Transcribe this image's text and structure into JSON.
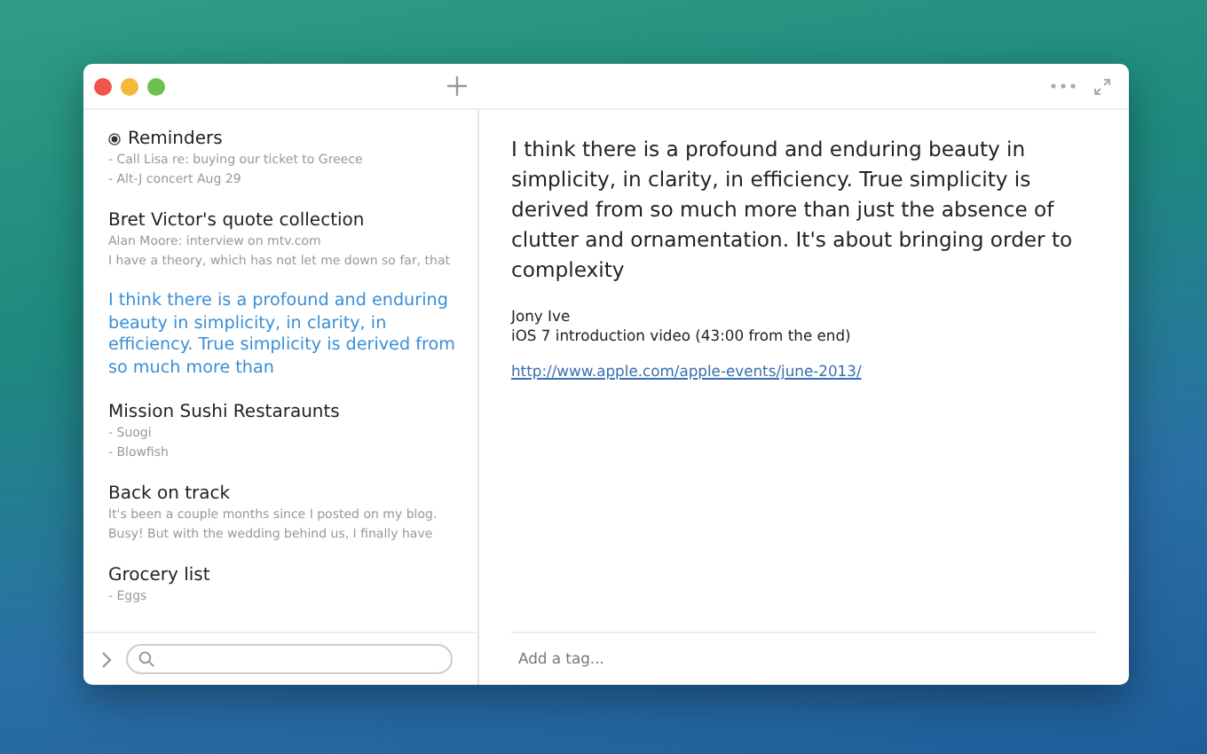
{
  "notes": [
    {
      "title": "Reminders",
      "pinned": true,
      "selected": false,
      "lines": [
        "- Call Lisa re: buying our ticket to Greece",
        "- Alt-J concert Aug 29"
      ]
    },
    {
      "title": "Bret Victor's quote collection",
      "pinned": false,
      "selected": false,
      "lines": [
        "Alan Moore: interview on mtv.com",
        "I have a theory, which has not let me down so far, that"
      ]
    },
    {
      "pinned": false,
      "selected": true,
      "lines": [
        "I think there is a profound and enduring beauty in simplicity, in clarity, in efficiency. True simplicity is derived from so much more than"
      ]
    },
    {
      "title": "Mission Sushi Restaraunts",
      "pinned": false,
      "selected": false,
      "lines": [
        "- Suogi",
        "- Blowfish"
      ]
    },
    {
      "title": "Back on track",
      "pinned": false,
      "selected": false,
      "lines": [
        "It's been a couple months since I posted on my blog.",
        "Busy! But with the wedding behind us, I finally have"
      ]
    },
    {
      "title": "Grocery list",
      "pinned": false,
      "selected": false,
      "lines": [
        "- Eggs"
      ]
    }
  ],
  "editor": {
    "body": "I think there is a profound and enduring beauty in simplicity, in clarity, in efficiency. True simplicity is derived from so much more than just the absence of clutter and ornamentation. It's about bringing order to complexity",
    "lines": [
      "Jony Ive",
      "iOS 7 introduction video (43:00 from the end)"
    ],
    "link": "http://www.apple.com/apple-events/june-2013/",
    "tag_placeholder": "Add a tag..."
  }
}
